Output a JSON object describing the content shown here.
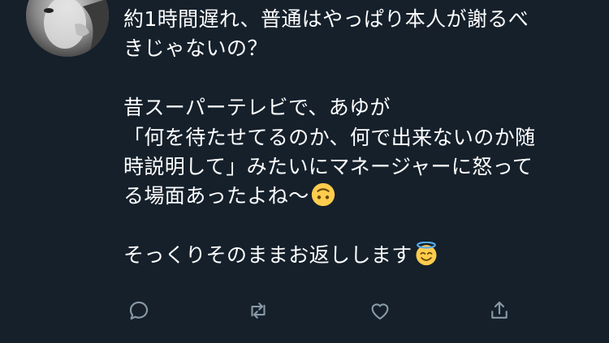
{
  "tweet": {
    "avatar": "profile-avatar",
    "paragraph1": "約1時間遅れ、普通はやっぱり本人が謝るべ\nきじゃないの？",
    "paragraph2": "昔スーパーテレビで、あゆが\n「何を待たせてるのか、何で出来ないのか随\n時説明して」みたいにマネージャーに怒って\nる場面あったよね〜",
    "paragraph2_emoji": "upside-down-face-emoji",
    "paragraph3": "そっくりそのままお返しします",
    "paragraph3_emoji": "smiling-face-with-halo-emoji"
  },
  "actions": {
    "icons": [
      "reply-icon",
      "retweet-icon",
      "like-icon",
      "share-icon"
    ],
    "icon_color": "#8899a6"
  },
  "colors": {
    "background": "#15202b",
    "text": "#ffffff"
  }
}
